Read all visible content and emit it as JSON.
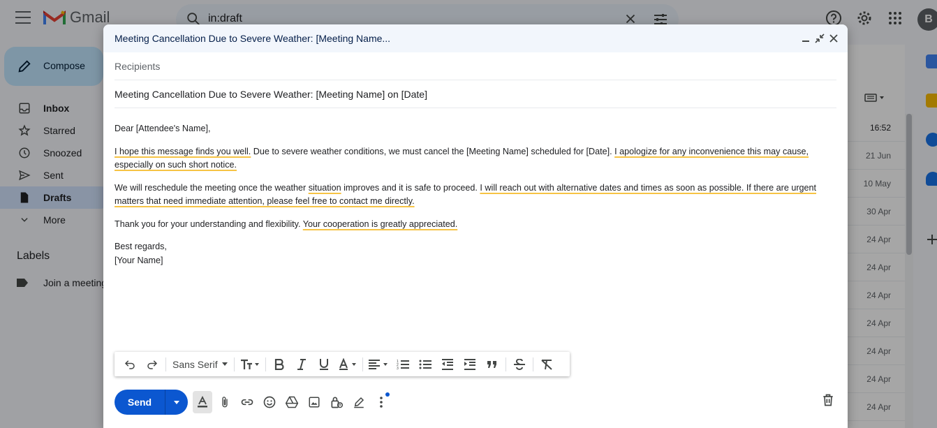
{
  "gmail": {
    "logo_text": "Gmail",
    "search_value": "in:draft",
    "avatar_letter": "B",
    "compose_label": "Compose",
    "nav": [
      {
        "label": "Inbox",
        "icon": "inbox-icon"
      },
      {
        "label": "Starred",
        "icon": "star-icon"
      },
      {
        "label": "Snoozed",
        "icon": "clock-icon"
      },
      {
        "label": "Sent",
        "icon": "send-icon"
      },
      {
        "label": "Drafts",
        "icon": "draft-icon"
      },
      {
        "label": "More",
        "icon": "chevron-down-icon"
      }
    ],
    "labels_title": "Labels",
    "label_items": [
      "Join a meeting"
    ],
    "dates": [
      "16:52",
      "21 Jun",
      "10 May",
      "30 Apr",
      "24 Apr",
      "24 Apr",
      "24 Apr",
      "24 Apr",
      "24 Apr",
      "24 Apr",
      "24 Apr"
    ],
    "colors": {
      "accent": "#0b57d0",
      "compose_bg": "#c2e7ff",
      "active_nav": "#d3e3fd",
      "spell_underline": "#f6c344"
    }
  },
  "compose": {
    "window_title": "Meeting Cancellation Due to Severe Weather: [Meeting Name...",
    "recipients_placeholder": "Recipients",
    "subject": "Meeting Cancellation Due to Severe Weather: [Meeting Name] on [Date]",
    "body": {
      "greeting": "Dear [Attendee's Name],",
      "p1": {
        "a": "I hope this message finds you well.",
        "b": " Due to severe weather conditions, we must cancel the [Meeting Name] scheduled for [Date]. ",
        "c": "I apologize for any inconvenience this may cause, especially on such short notice."
      },
      "p2": {
        "a": "We will reschedule the meeting once the weather ",
        "b": "situation",
        "c": " improves and it is safe to proceed. ",
        "d": "I will reach out with alternative dates and times as soon as possible. If there are urgent matters that need immediate attention, please feel free to contact me directly."
      },
      "p3": {
        "a": "Thank you for your understanding and flexibility. ",
        "b": "Your cooperation is greatly appreciated."
      },
      "closing": "Best regards,",
      "signature": "[Your Name]"
    },
    "toolbar": {
      "font": "Sans Serif",
      "buttons": [
        "undo-icon",
        "redo-icon",
        "text-size-icon",
        "bold-icon",
        "italic-icon",
        "underline-icon",
        "text-color-icon",
        "align-icon",
        "numbered-list-icon",
        "bulleted-list-icon",
        "indent-less-icon",
        "indent-more-icon",
        "quote-icon",
        "strikethrough-icon",
        "remove-formatting-icon"
      ]
    },
    "send_label": "Send"
  }
}
